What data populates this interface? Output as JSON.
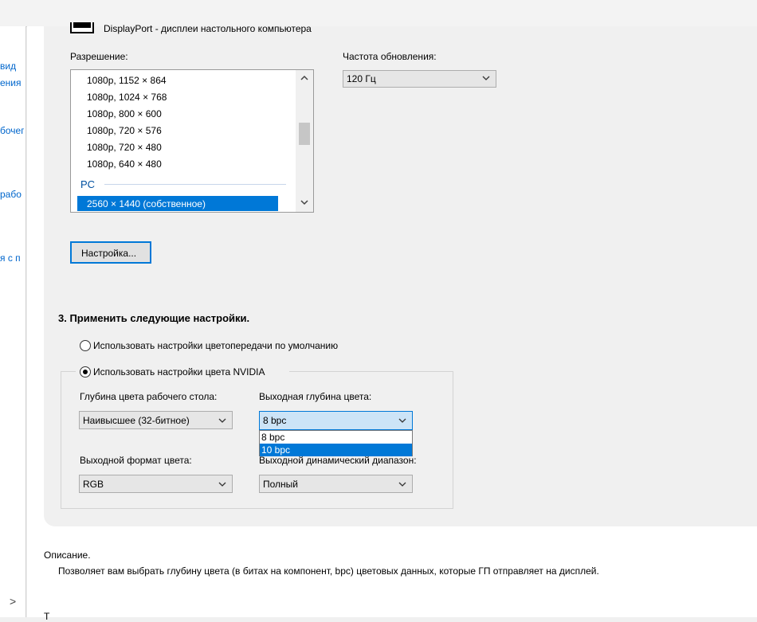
{
  "header": {
    "display_name": "DisplayPort - дисплеи настольного компьютера"
  },
  "left_nav": {
    "items": [
      "вид",
      "ения ,",
      "бочег",
      "рабо",
      "я с п"
    ]
  },
  "resolution": {
    "label": "Разрешение:",
    "items": [
      "1080p, 1152 × 864",
      "1080p, 1024 × 768",
      "1080p, 800 × 600",
      "1080p, 720 × 576",
      "1080p, 720 × 480",
      "1080p, 640 × 480"
    ],
    "group_pc": "PC",
    "selected": "2560 × 1440 (собственное)"
  },
  "refresh": {
    "label": "Частота обновления:",
    "value": "120 Гц"
  },
  "customize_button": "Настройка...",
  "apply_section": {
    "title": "3. Применить следующие настройки.",
    "radio_default": "Использовать настройки цветопередачи по умолчанию",
    "radio_nvidia": "Использовать настройки цвета NVIDIA",
    "selected_radio": "nvidia"
  },
  "color_settings": {
    "desktop_depth_label": "Глубина цвета рабочего стола:",
    "desktop_depth_value": "Наивысшее (32-битное)",
    "output_depth_label": "Выходная глубина цвета:",
    "output_depth_value": "8 bpc",
    "output_depth_options": [
      "8 bpc",
      "10 bpc"
    ],
    "output_depth_highlighted": "10 bpc",
    "output_format_label": "Выходной формат цвета:",
    "output_format_value": "RGB",
    "dynamic_range_label": "Выходной динамический диапазон:",
    "dynamic_range_value": "Полный"
  },
  "description": {
    "label": "Описание.",
    "text": "Позволяет вам выбрать глубину цвета (в битах на компонент, bpc) цветовых данных, которые ГП отправляет на дисплей."
  },
  "bottom_cut_text": "Т",
  "scroll_right_glyph": ">"
}
